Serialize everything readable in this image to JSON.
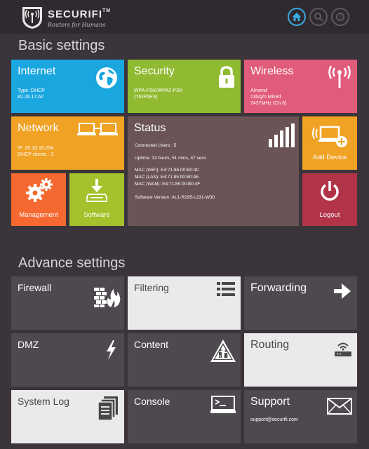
{
  "header": {
    "brand": "SECURIFI",
    "tm": "TM",
    "tagline": "Routers for Humans",
    "buttons": [
      {
        "name": "home-icon",
        "active": true
      },
      {
        "name": "search-icon",
        "active": false
      },
      {
        "name": "support-icon",
        "active": false
      }
    ]
  },
  "basic": {
    "title": "Basic settings",
    "internet": {
      "title": "Internet",
      "type": "Type :DHCP",
      "ip": "82.26.17.62"
    },
    "security": {
      "title": "Security",
      "mode": "WPA-PSK/WPA2-PSK",
      "cipher": "(TKIPAES)"
    },
    "wireless": {
      "title": "Wireless",
      "ssid": "Almond",
      "mode": "11b/g/n Mixed",
      "channel": "2437MHz (Ch 6)"
    },
    "network": {
      "title": "Network",
      "ip": "IP: 20.10.10.254",
      "clients": "DHCP clients : 3"
    },
    "status": {
      "title": "Status",
      "users": "Connected Users : 5",
      "uptime": "Uptime: 13 hours, 51 mins, 47 secs",
      "mac_wifi": "MAC (WiFi): E4:71:85:00:B0:4C",
      "mac_lan": "MAC (LAN): E4:71:85:00:B0:4E",
      "mac_wan": "MAC (WAN): E4:71:85:00:B0:4F",
      "software": "Software Version :AL1-R195-L231-W30"
    },
    "add_device": {
      "label": "Add Device"
    },
    "management": {
      "label": "Management"
    },
    "software": {
      "label": "Software"
    },
    "logout": {
      "label": "Logout"
    }
  },
  "advance": {
    "title": "Advance settings",
    "firewall": "Firewall",
    "filtering": "Filtering",
    "forwarding": "Forwarding",
    "dmz": "DMZ",
    "content": "Content",
    "routing": "Routing",
    "system_log": "System Log",
    "console": "Console",
    "support": {
      "title": "Support",
      "email": "support@securifi.com"
    }
  },
  "colors": {
    "internet": "#1aa6df",
    "security": "#8fba31",
    "wireless": "#e15b7a",
    "network": "#f0a224",
    "status": "#6b5455",
    "add_device": "#f0a224",
    "management": "#f56931",
    "software": "#a3c22b",
    "logout": "#b13449",
    "dark_tile": "#4e494f",
    "light_tile": "#eaeaea",
    "header_active": "#38a9e0"
  }
}
